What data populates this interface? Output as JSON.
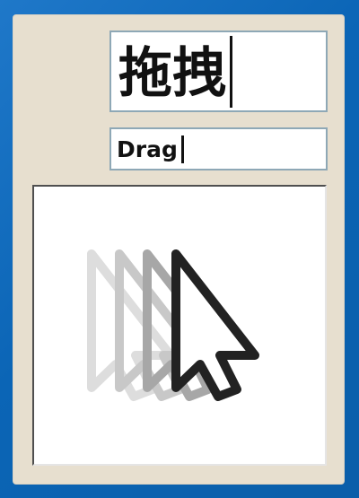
{
  "window": {
    "input_primary_value": "拖拽",
    "input_secondary_value": "Drag"
  },
  "preview": {
    "icon": "drag-cursor-motion-icon"
  },
  "colors": {
    "desktop_blue": "#0b65b6",
    "panel_beige": "#e7dfcf",
    "field_border": "#8ea8b6",
    "text": "#111111",
    "cursor_shadow_1": "#dddddd",
    "cursor_shadow_2": "#c8c8c8",
    "cursor_shadow_3": "#a7a7a7",
    "cursor_main": "#222222"
  }
}
